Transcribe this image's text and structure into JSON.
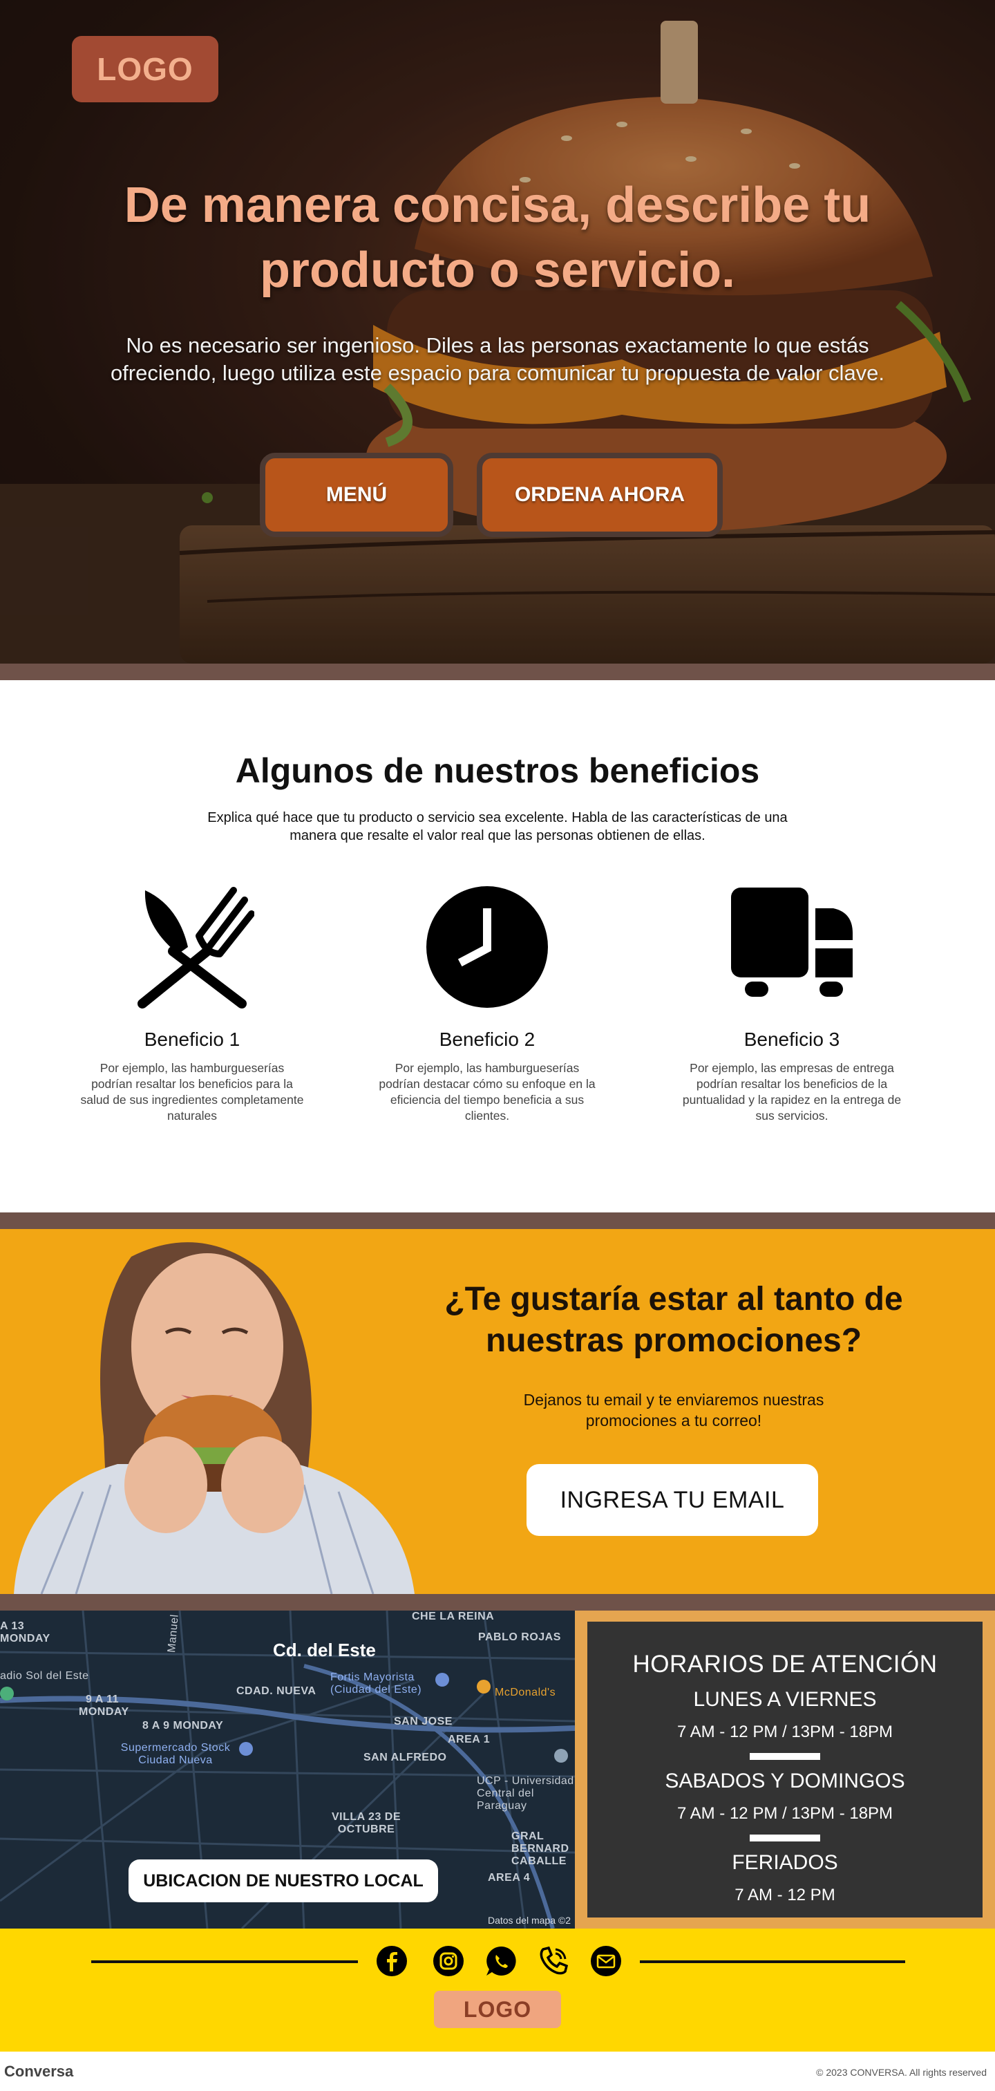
{
  "hero": {
    "logo": "LOGO",
    "title": "De manera concisa, describe tu producto o servicio.",
    "subtitle": "No es necesario ser ingenioso. Diles a las personas exactamente lo que estás ofreciendo, luego utiliza este espacio para comunicar tu propuesta de valor clave.",
    "buttons": {
      "menu": "MENÚ",
      "order": "ORDENA AHORA"
    }
  },
  "benefits": {
    "title": "Algunos de nuestros beneficios",
    "subtitle": "Explica qué hace que tu producto o servicio sea excelente. Habla de las características de una manera que resalte el valor real que las personas obtienen de ellas.",
    "items": [
      {
        "icon": "utensils-icon",
        "title": "Beneficio 1",
        "text": "Por ejemplo, las hamburgueserías podrían resaltar los beneficios para la salud de sus ingredientes completamente naturales"
      },
      {
        "icon": "clock-icon",
        "title": "Beneficio 2",
        "text": "Por ejemplo, las hamburgueserías podrían destacar cómo su enfoque en la eficiencia del tiempo beneficia a sus clientes."
      },
      {
        "icon": "delivery-truck-icon",
        "title": "Beneficio 3",
        "text": "Por ejemplo, las empresas de entrega podrían resaltar los beneficios de la puntualidad y la rapidez en la entrega de sus servicios."
      }
    ]
  },
  "promo": {
    "title": "¿Te gustaría estar al tanto de nuestras promociones?",
    "text": "Dejanos tu email y te enviaremos nuestras promociones a tu correo!",
    "email_button": "INGRESA TU EMAIL"
  },
  "map": {
    "title": "Cd. del Este",
    "labels": [
      "CHE LA REINA",
      "PABLO ROJAS",
      "adio Sol del Este",
      "A 13",
      "MONDAY",
      "9 A 11",
      "MONDAY",
      "8 A 9 MONDAY",
      "CDAD. NUEVA",
      "Fortis Mayorista (Ciudad del Este)",
      "McDonald's",
      "SAN JOSE",
      "AREA 1",
      "SAN ALFREDO",
      "Supermercado Stock Ciudad Nueva",
      "UCP - Universidad Central del Paraguay",
      "VILLA 23 DE OCTUBRE",
      "GRAL BERNARD CABALLE",
      "AREA 4",
      "Manuel Franco"
    ],
    "button": "UBICACION DE NUESTRO LOCAL",
    "credit": "Datos del mapa ©2"
  },
  "hours": {
    "title": "HORARIOS DE ATENCIÓN",
    "weekday_label": "LUNES A VIERNES",
    "weekday_time": "7 AM - 12 PM / 13PM - 18PM",
    "weekend_label": "SABADOS Y DOMINGOS",
    "weekend_time": "7 AM - 12 PM / 13PM - 18PM",
    "holiday_label": "FERIADOS",
    "holiday_time": "7 AM - 12 PM"
  },
  "footer": {
    "social_icons": [
      "facebook-icon",
      "instagram-icon",
      "whatsapp-icon",
      "phone-icon",
      "email-icon"
    ],
    "logo": "LOGO",
    "brand": "Conversa",
    "copyright": "© 2023 CONVERSA. All rights reserved"
  },
  "colors": {
    "hero_button": "#b8551a",
    "promo_bg": "#f2a614",
    "footer_bg": "#ffd700",
    "divider_band": "#6f5249",
    "hours_border": "#e5a550"
  }
}
